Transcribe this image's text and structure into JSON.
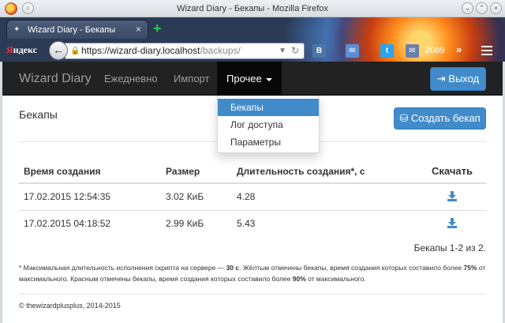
{
  "window": {
    "title": "Wizard Diary - Бекапы - Mozilla Firefox"
  },
  "browser": {
    "tab_title": "Wizard Diary - Бекапы",
    "tab_close": "×",
    "new_tab": "+",
    "yandex_red": "Я",
    "yandex_rest": "ндекс",
    "url_host": "https://wizard-diary.localhost",
    "url_path": "/backups/",
    "toolbar_icons": [
      "vk-icon",
      "mail-icon",
      "twitter-icon",
      "message-icon"
    ],
    "counter": "2089"
  },
  "nav": {
    "brand": "Wizard Diary",
    "links": [
      "Ежедневно",
      "Импорт"
    ],
    "active": "Прочее",
    "exit_label": "Выход"
  },
  "dropdown": {
    "items": [
      "Бекапы",
      "Лог доступа",
      "Параметры"
    ],
    "active_index": 0
  },
  "main": {
    "heading": "Бекапы",
    "create_label": "Создать бекап",
    "columns": [
      "Время создания",
      "Размер",
      "Длительность создания*, с",
      "Скачать"
    ],
    "rows": [
      {
        "time": "17.02.2015 12:54:35",
        "size": "3.02 КиБ",
        "duration": "4.28"
      },
      {
        "time": "17.02.2015 04:18:52",
        "size": "2.99 КиБ",
        "duration": "5.43"
      }
    ],
    "summary": "Бекапы 1-2 из 2.",
    "note": {
      "p1": "* Максимальная длительность исполнения скрипта на сервере — ",
      "b1": "30 с",
      "p2": ". Жёлтым отмечены бекапы, время создания которых составило более ",
      "b2": "75%",
      "p3": " от максимального. Красным отмечены бекапы, время создания которых составило более ",
      "b3": "90%",
      "p4": " от максимального."
    }
  },
  "footer": "© thewizardplusplus, 2014-2015",
  "colors": {
    "primary": "#428bca",
    "navbar": "#222222"
  }
}
